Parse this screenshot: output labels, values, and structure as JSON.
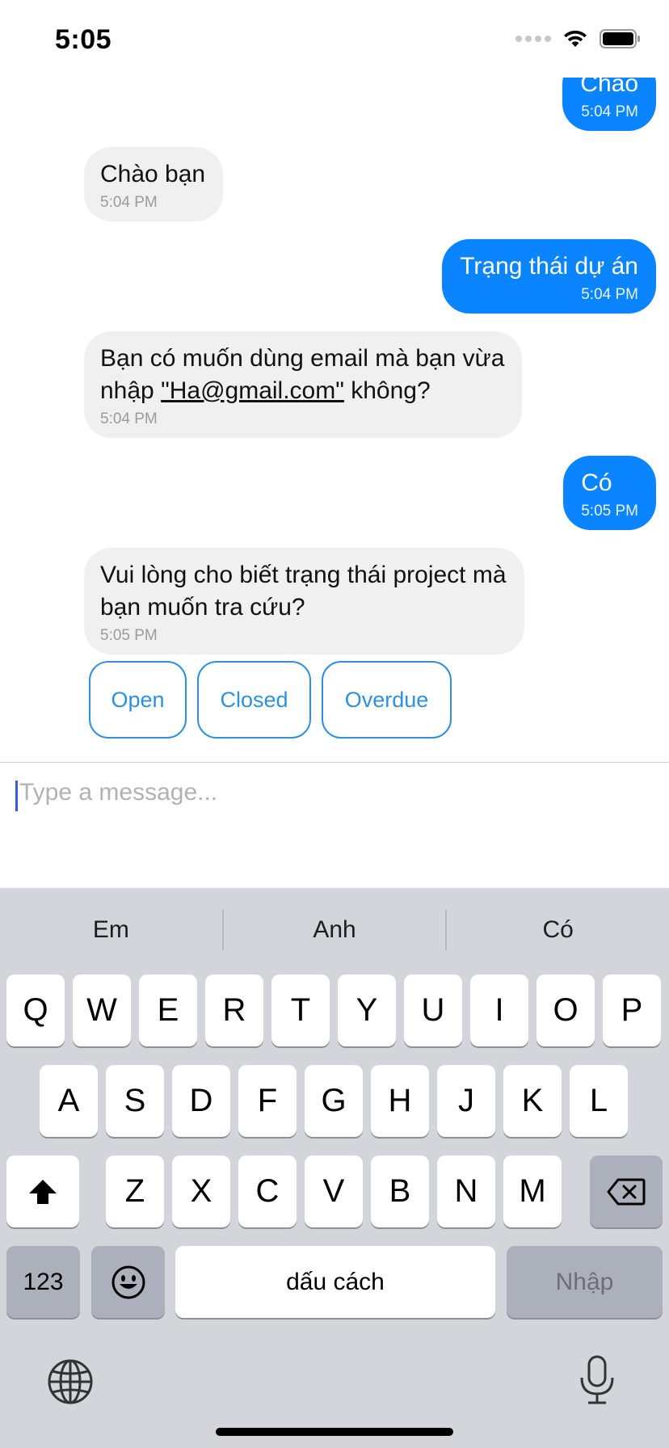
{
  "status_bar": {
    "time": "5:05"
  },
  "messages": [
    {
      "from": "user",
      "text": "Chào",
      "time": "5:04 PM"
    },
    {
      "from": "bot",
      "text": "Chào bạn",
      "time": "5:04 PM"
    },
    {
      "from": "user",
      "text": "Trạng thái dự án",
      "time": "5:04 PM"
    },
    {
      "from": "bot",
      "text_before": "Bạn có muốn dùng email mà bạn vừa\nnhập ",
      "text_link": "\"Ha@gmail.com\"",
      "text_after": " không?",
      "time": "5:04 PM"
    },
    {
      "from": "user",
      "text": "Có",
      "time": "5:05 PM"
    },
    {
      "from": "bot",
      "text": "Vui lòng cho biết trạng thái project mà\nbạn muốn tra cứu?",
      "time": "5:05 PM"
    }
  ],
  "quick_replies": [
    "Open",
    "Closed",
    "Overdue"
  ],
  "composer": {
    "placeholder": "Type a message..."
  },
  "keyboard": {
    "suggestions": [
      "Em",
      "Anh",
      "Có"
    ],
    "row1": [
      "Q",
      "W",
      "E",
      "R",
      "T",
      "Y",
      "U",
      "I",
      "O",
      "P"
    ],
    "row2": [
      "A",
      "S",
      "D",
      "F",
      "G",
      "H",
      "J",
      "K",
      "L"
    ],
    "row3": [
      "Z",
      "X",
      "C",
      "V",
      "B",
      "N",
      "M"
    ],
    "numbers_label": "123",
    "space_label": "dấu cách",
    "return_label": "Nhập"
  },
  "colors": {
    "user_bubble": "#0a84ff",
    "bot_bubble": "#f0f0f0",
    "quick_reply": "#2f8fe0",
    "keyboard_bg": "#d3d5db"
  }
}
